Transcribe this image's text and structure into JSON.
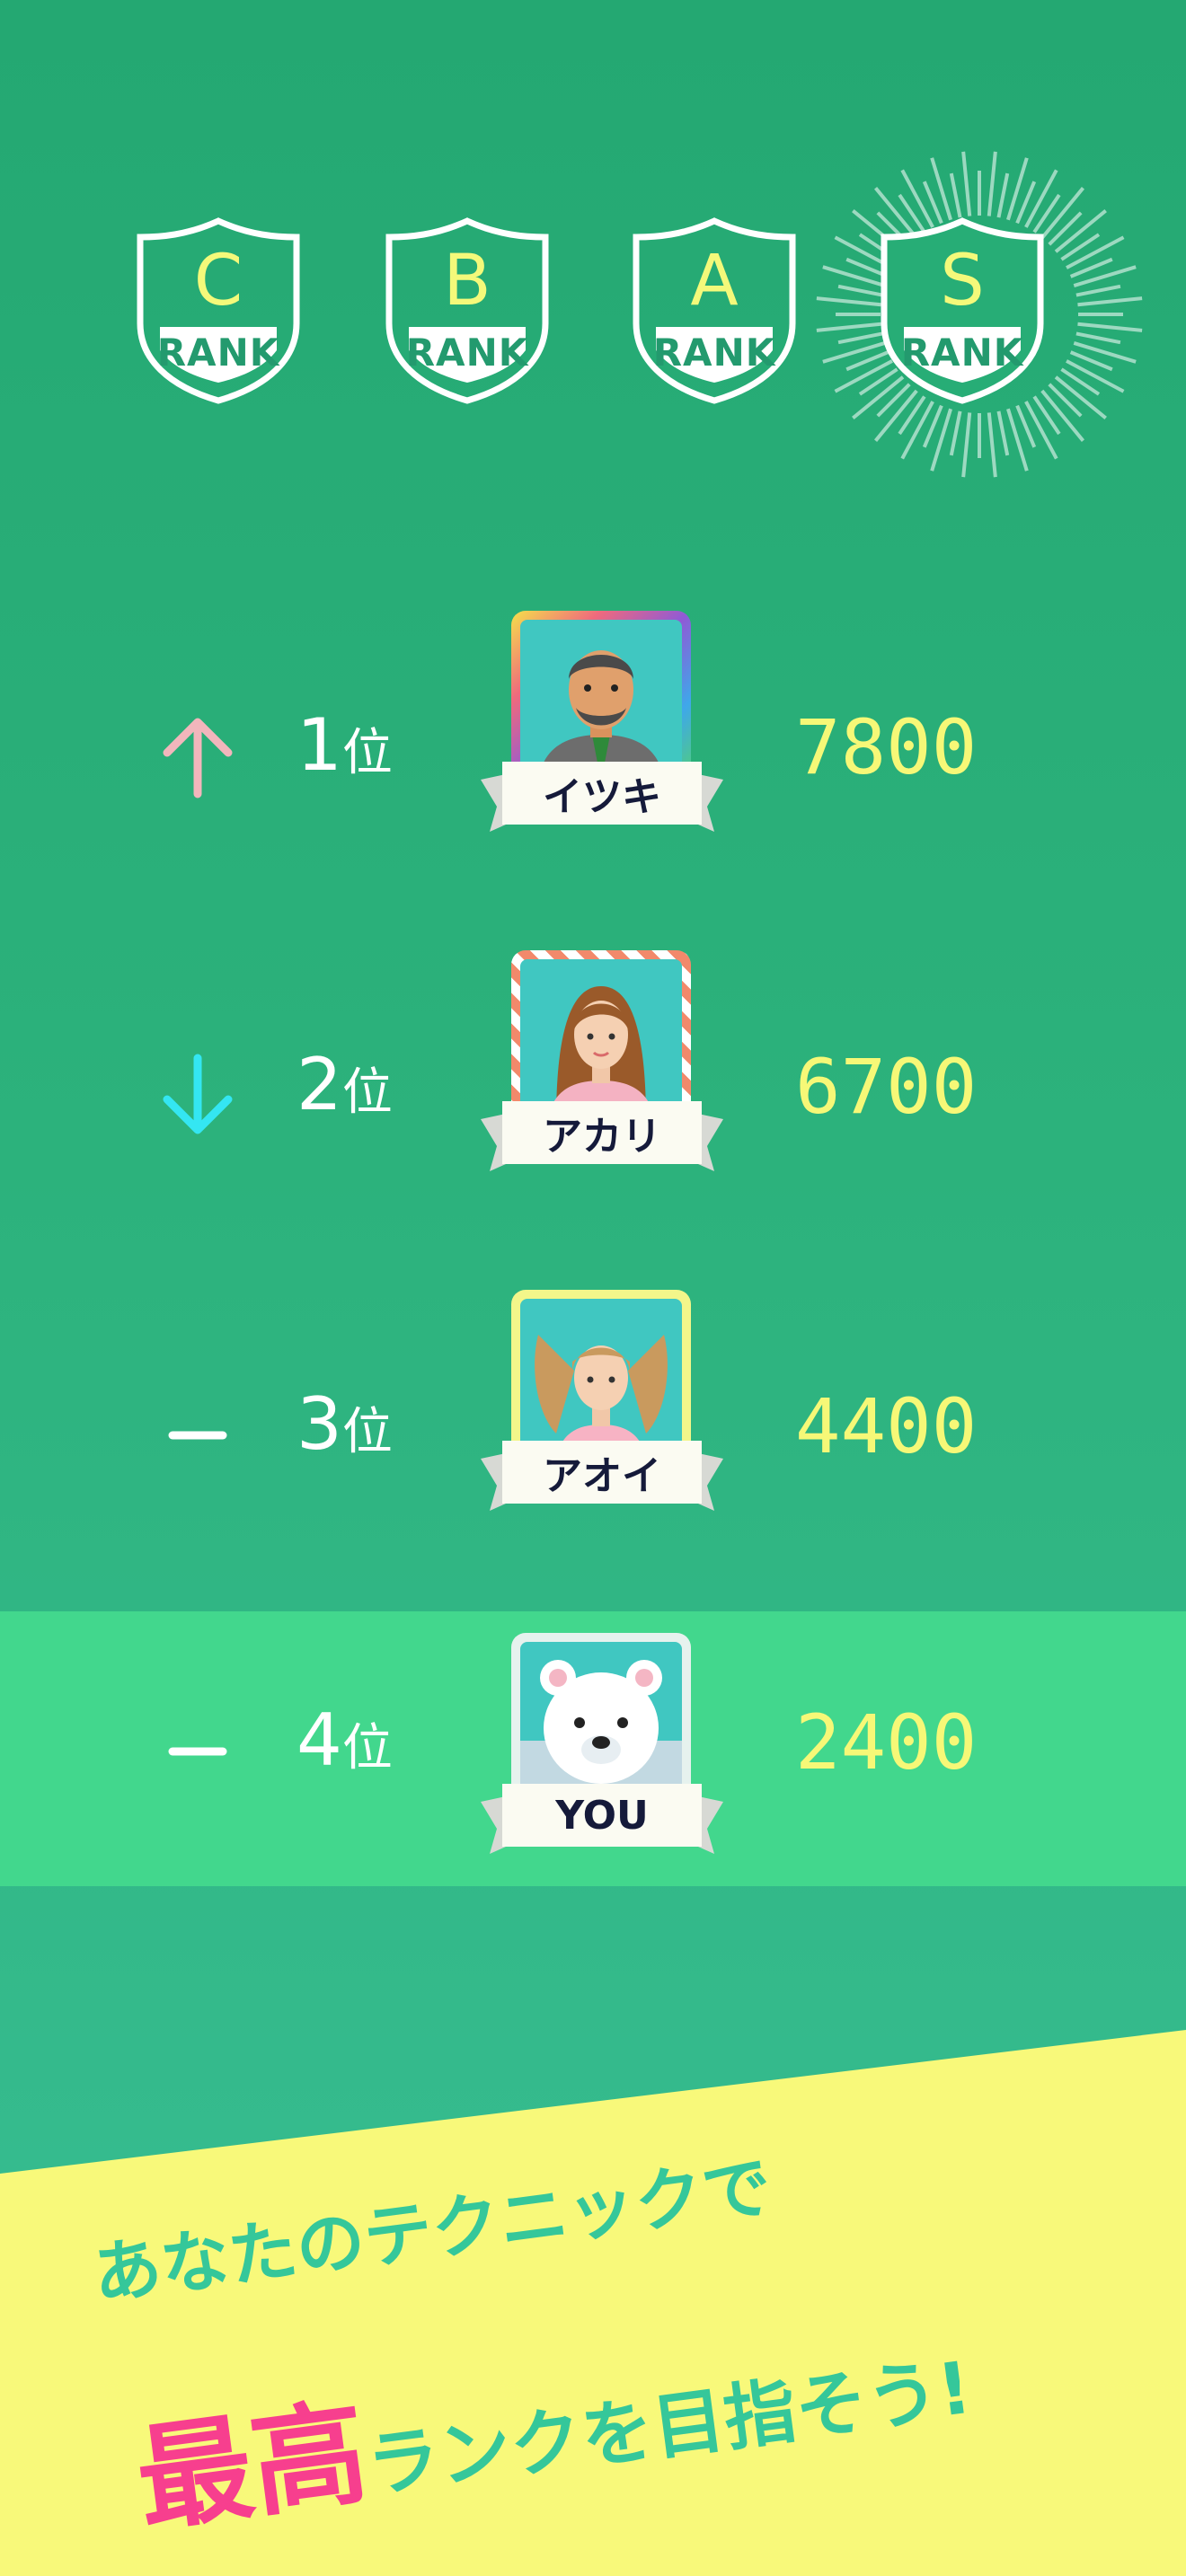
{
  "ranks": [
    {
      "letter": "C",
      "label": "RANK",
      "highlighted": false
    },
    {
      "letter": "B",
      "label": "RANK",
      "highlighted": false
    },
    {
      "letter": "A",
      "label": "RANK",
      "highlighted": false
    },
    {
      "letter": "S",
      "label": "RANK",
      "highlighted": true
    }
  ],
  "leaderboard": [
    {
      "trend": "up",
      "trend_icon": "arrow-up-icon",
      "position": "1",
      "position_suffix": "位",
      "name": "イツキ",
      "score": "7800",
      "is_you": false
    },
    {
      "trend": "down",
      "trend_icon": "arrow-down-icon",
      "position": "2",
      "position_suffix": "位",
      "name": "アカリ",
      "score": "6700",
      "is_you": false
    },
    {
      "trend": "same",
      "trend_icon": "dash-icon",
      "position": "3",
      "position_suffix": "位",
      "name": "アオイ",
      "score": "4400",
      "is_you": false
    },
    {
      "trend": "same",
      "trend_icon": "dash-icon",
      "position": "4",
      "position_suffix": "位",
      "name": "YOU",
      "score": "2400",
      "is_you": true
    }
  ],
  "tagline": {
    "line1": "あなたのテクニックで",
    "line2_accent": "最高",
    "line2_rest": "ランクを目指そう!"
  },
  "colors": {
    "background": "#27ad76",
    "highlight_row": "#42d78d",
    "score": "#f6f877",
    "accent_pink": "#f73f8e",
    "tagline_band": "#f8f97a",
    "trend_up": "#f2b6bc",
    "trend_down": "#34e6f2"
  }
}
